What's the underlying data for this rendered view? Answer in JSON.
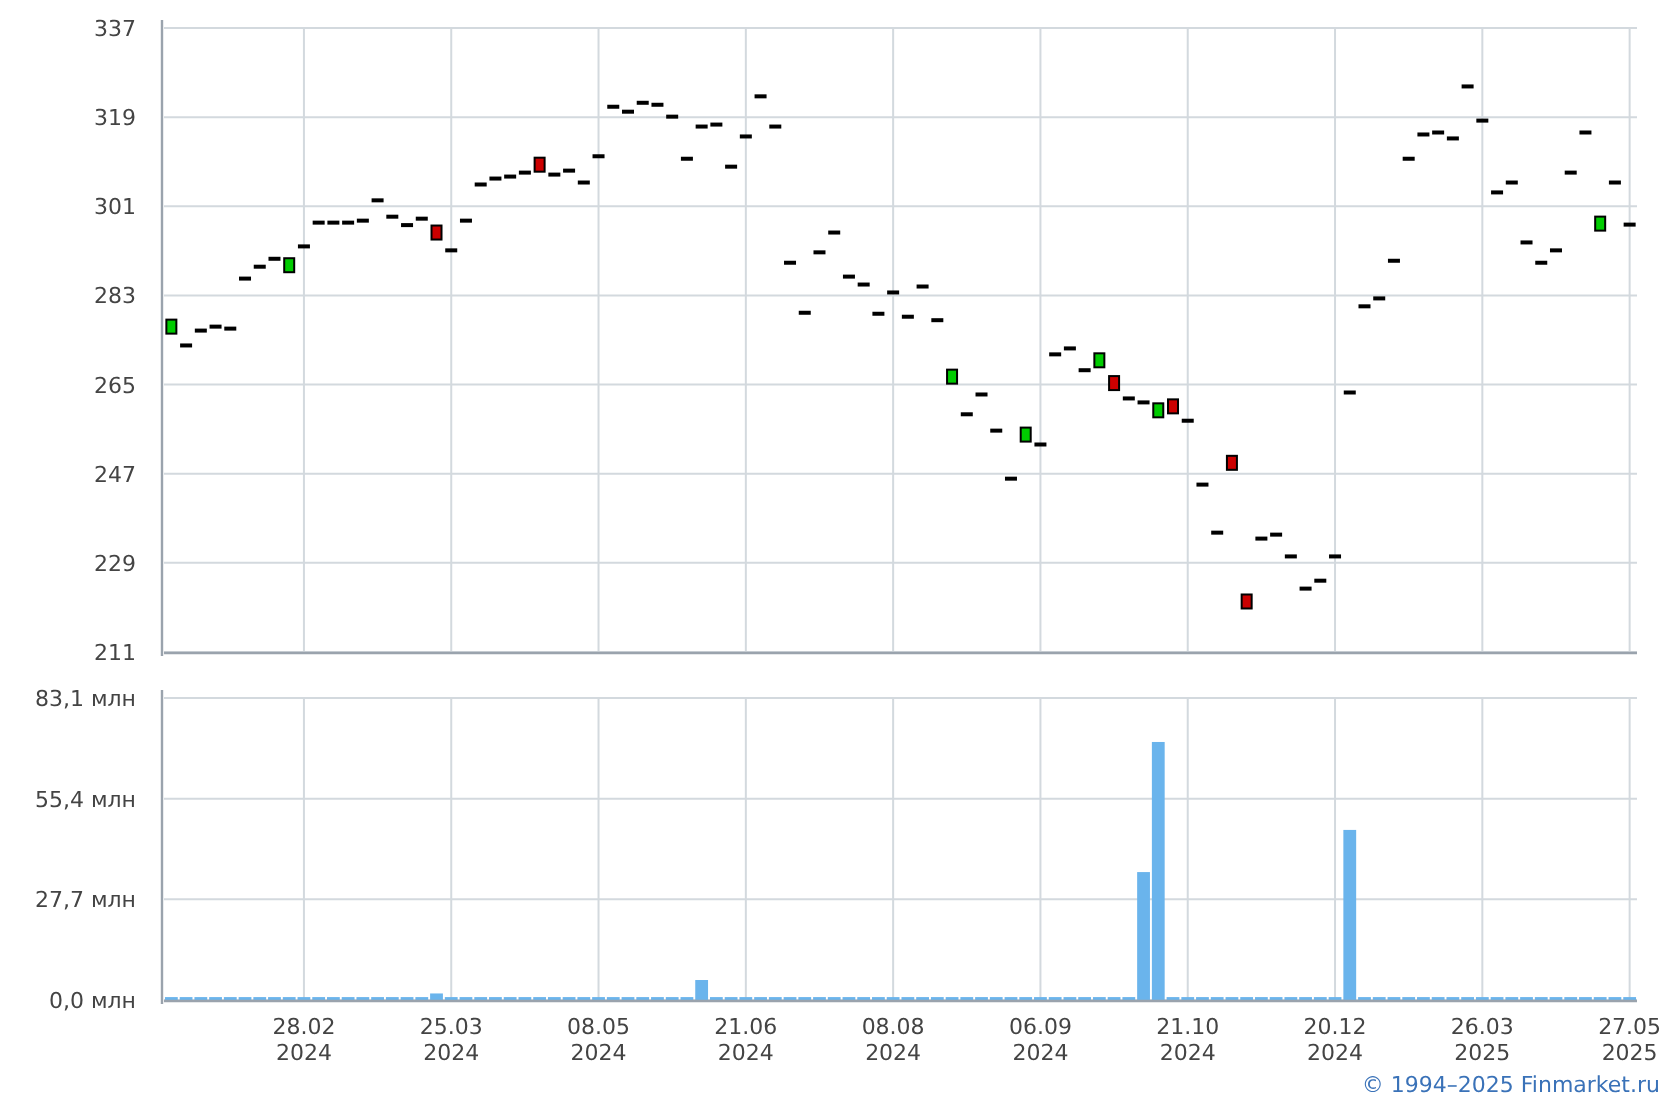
{
  "price_chart": {
    "chart_data": {
      "type": "scatter",
      "grid": true,
      "categories": [
        null,
        null,
        null,
        null,
        null,
        null,
        null,
        null,
        null,
        null,
        null,
        null,
        null,
        null,
        null,
        null,
        null,
        null,
        null,
        null,
        null,
        null,
        null,
        null,
        null,
        null,
        null,
        null,
        null,
        null,
        null,
        null,
        null,
        null,
        null,
        null,
        null,
        null,
        null,
        null,
        null,
        null,
        null,
        null,
        null,
        null,
        null,
        null,
        null,
        null,
        null,
        null,
        null,
        null,
        null,
        null,
        null,
        null,
        null,
        null,
        null,
        null,
        null,
        null,
        null,
        null,
        null,
        null,
        null,
        null,
        null,
        null,
        null,
        null,
        null,
        null,
        null,
        null,
        null,
        null,
        null,
        null,
        null,
        null,
        null,
        null,
        null,
        null,
        null,
        null,
        null,
        null,
        null,
        null,
        null,
        null,
        null,
        null,
        null,
        null
      ],
      "ylim": [
        211,
        337
      ],
      "yticks": [
        211,
        229,
        247,
        265,
        283,
        301,
        319,
        337
      ],
      "series": [
        {
          "color": "#000000",
          "values": [
            null,
            272.9,
            275.9,
            276.7,
            276.3,
            286.4,
            288.8,
            290.4,
            null,
            292.9,
            297.7,
            297.7,
            297.7,
            298.1,
            302.2,
            298.9,
            297.2,
            298.5,
            null,
            292.1,
            298.1,
            305.4,
            306.6,
            307.0,
            307.8,
            null,
            307.4,
            308.2,
            305.8,
            311.1,
            321.1,
            320.1,
            321.9,
            321.5,
            319.1,
            310.6,
            317.1,
            317.5,
            309.0,
            315.1,
            323.2,
            317.1,
            289.6,
            279.5,
            291.7,
            295.7,
            286.8,
            285.2,
            279.3,
            283.6,
            278.7,
            284.8,
            278.0,
            null,
            259.0,
            263.0,
            255.7,
            246.0,
            null,
            252.9,
            271.1,
            272.3,
            267.9,
            null,
            null,
            262.2,
            261.4,
            null,
            null,
            257.7,
            244.8,
            235.1,
            null,
            null,
            233.9,
            234.7,
            230.3,
            223.8,
            225.4,
            230.3,
            263.4,
            280.8,
            282.4,
            290.0,
            310.6,
            315.5,
            315.9,
            314.7,
            325.2,
            318.3,
            303.8,
            305.8,
            293.7,
            289.6,
            292.1,
            307.8,
            315.9,
            null,
            305.8,
            297.3
          ]
        },
        {
          "color": "#00cc00",
          "values": [
            276.7,
            null,
            null,
            null,
            null,
            null,
            null,
            null,
            289.1,
            null,
            null,
            null,
            null,
            null,
            null,
            null,
            null,
            null,
            null,
            null,
            null,
            null,
            null,
            null,
            null,
            null,
            null,
            null,
            null,
            null,
            null,
            null,
            null,
            null,
            null,
            null,
            null,
            null,
            null,
            null,
            null,
            null,
            null,
            null,
            null,
            null,
            null,
            null,
            null,
            null,
            null,
            null,
            null,
            266.6,
            null,
            null,
            null,
            null,
            254.9,
            null,
            null,
            null,
            null,
            269.9,
            null,
            null,
            null,
            259.8,
            null,
            null,
            null,
            null,
            null,
            null,
            null,
            null,
            null,
            null,
            null,
            null,
            null,
            null,
            null,
            null,
            null,
            null,
            null,
            null,
            null,
            null,
            null,
            null,
            null,
            null,
            null,
            null,
            null,
            297.5,
            null,
            null
          ]
        },
        {
          "color": "#cc0000",
          "values": [
            null,
            null,
            null,
            null,
            null,
            null,
            null,
            null,
            null,
            null,
            null,
            null,
            null,
            null,
            null,
            null,
            null,
            null,
            295.7,
            null,
            null,
            null,
            null,
            null,
            null,
            309.4,
            null,
            null,
            null,
            null,
            null,
            null,
            null,
            null,
            null,
            null,
            null,
            null,
            null,
            null,
            null,
            null,
            null,
            null,
            null,
            null,
            null,
            null,
            null,
            null,
            null,
            null,
            null,
            null,
            null,
            null,
            null,
            null,
            null,
            null,
            null,
            null,
            null,
            null,
            265.3,
            null,
            null,
            null,
            260.6,
            null,
            null,
            null,
            249.2,
            221.2,
            null,
            null,
            null,
            null,
            null,
            null,
            null,
            null,
            null,
            null,
            null,
            null,
            null,
            null,
            null,
            null,
            null,
            null,
            null,
            null,
            null,
            null,
            null,
            null,
            null,
            null
          ]
        }
      ]
    }
  },
  "volume_chart": {
    "chart_data": {
      "type": "bar",
      "grid": true,
      "categories": [
        null,
        null,
        null,
        null,
        null,
        null,
        null,
        null,
        null,
        "28.02\n2024",
        null,
        null,
        null,
        null,
        null,
        null,
        null,
        null,
        null,
        "25.03\n2024",
        null,
        null,
        null,
        null,
        null,
        null,
        null,
        null,
        null,
        "08.05\n2024",
        null,
        null,
        null,
        null,
        null,
        null,
        null,
        null,
        null,
        "21.06\n2024",
        null,
        null,
        null,
        null,
        null,
        null,
        null,
        null,
        null,
        "08.08\n2024",
        null,
        null,
        null,
        null,
        null,
        null,
        null,
        null,
        null,
        "06.09\n2024",
        null,
        null,
        null,
        null,
        null,
        null,
        null,
        null,
        null,
        "21.10\n2024",
        null,
        null,
        null,
        null,
        null,
        null,
        null,
        null,
        null,
        "20.12\n2024",
        null,
        null,
        null,
        null,
        null,
        null,
        null,
        null,
        null,
        "26.03\n2025",
        null,
        null,
        null,
        null,
        null,
        null,
        null,
        null,
        null,
        "27.05\n2025"
      ],
      "ylim": [
        0,
        83.1
      ],
      "yticks": [
        {
          "value": 0,
          "label": "0,0 млн"
        },
        {
          "value": 27.7,
          "label": "27,7 млн"
        },
        {
          "value": 55.4,
          "label": "55,4 млн"
        },
        {
          "value": 83.1,
          "label": "83,1 млн"
        }
      ],
      "series": [
        {
          "color": "#6ab4ec",
          "values": [
            0.8,
            0.8,
            0.8,
            0.8,
            0.8,
            0.8,
            0.8,
            0.8,
            0.8,
            0.8,
            0.8,
            0.8,
            0.8,
            0.8,
            0.8,
            0.8,
            0.8,
            0.8,
            1.8,
            0.8,
            0.8,
            0.8,
            0.8,
            0.8,
            0.8,
            0.8,
            0.8,
            0.8,
            0.8,
            0.8,
            0.8,
            0.8,
            0.8,
            0.8,
            0.8,
            0.8,
            5.5,
            0.8,
            0.8,
            0.8,
            0.8,
            0.8,
            0.8,
            0.8,
            0.8,
            0.8,
            0.8,
            0.8,
            0.8,
            0.8,
            0.8,
            0.8,
            0.8,
            0.8,
            0.8,
            0.8,
            0.8,
            0.8,
            0.8,
            0.8,
            0.8,
            0.8,
            0.8,
            0.8,
            0.8,
            0.8,
            35.2,
            71.0,
            0.8,
            0.8,
            0.8,
            0.8,
            0.8,
            0.8,
            0.8,
            0.8,
            0.8,
            0.8,
            0.8,
            0.8,
            46.8,
            0.8,
            0.8,
            0.8,
            0.8,
            0.8,
            0.8,
            0.8,
            0.8,
            0.8,
            0.8,
            0.8,
            0.8,
            0.8,
            0.8,
            0.8,
            0.8,
            0.8,
            0.8,
            0.8
          ]
        }
      ]
    }
  },
  "copyright": "© 1994–2025 Finmarket.ru"
}
